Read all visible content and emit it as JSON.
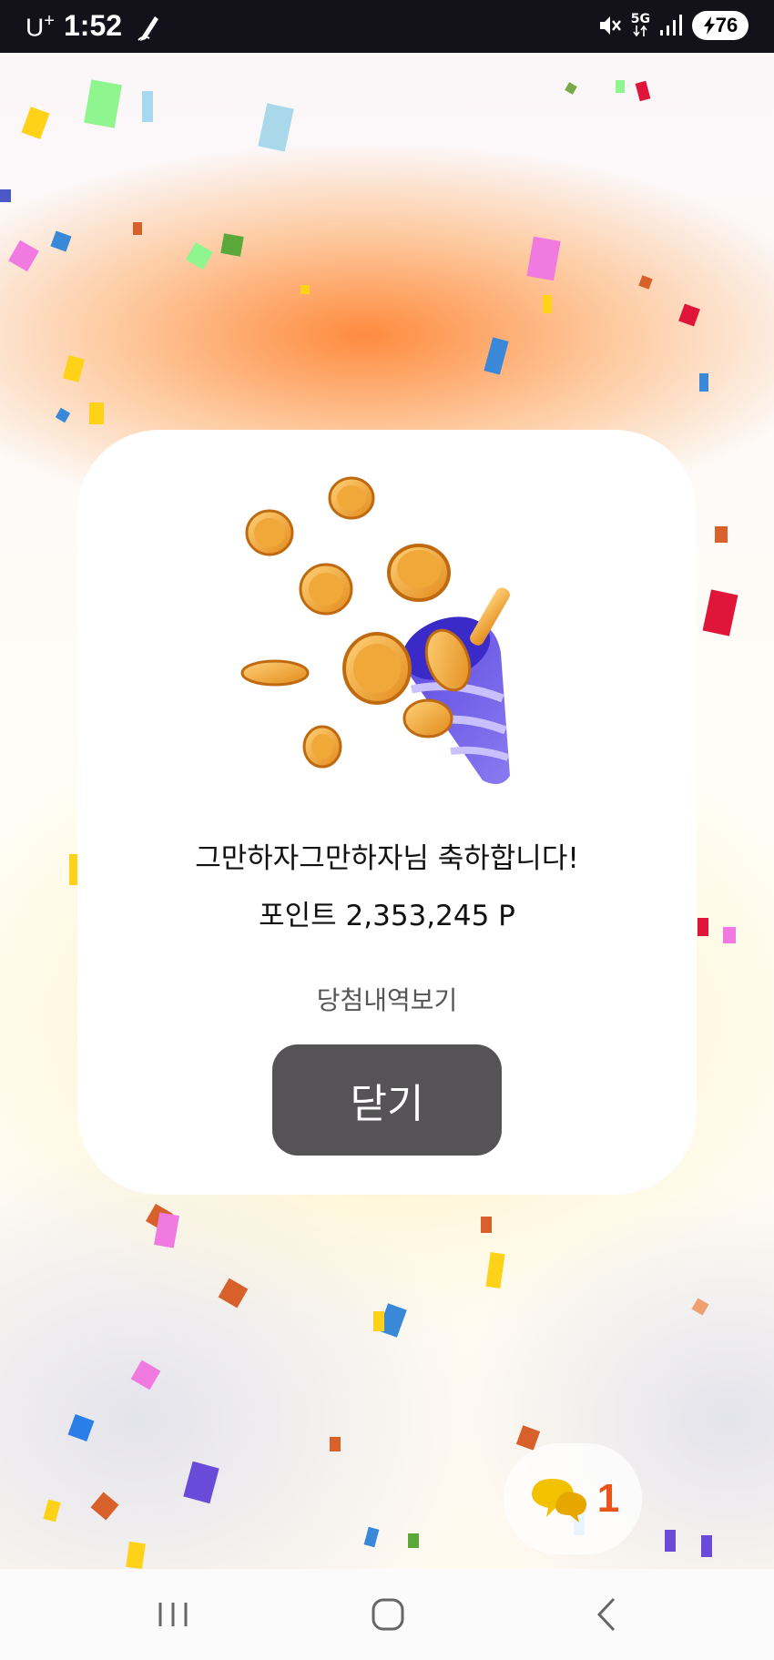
{
  "status_bar": {
    "carrier": "U",
    "carrier_sup": "+",
    "time": "1:52",
    "network": "5G",
    "battery": "76"
  },
  "modal": {
    "title": "그만하자그만하자님 축하합니다!",
    "points": "포인트 2,353,245 P",
    "history_link": "당첨내역보기",
    "close_label": "닫기"
  },
  "chat": {
    "count": "1"
  },
  "colors": {
    "close_button": "#555356",
    "chat_count": "#e8541a",
    "status_bar_bg": "#13121a"
  }
}
